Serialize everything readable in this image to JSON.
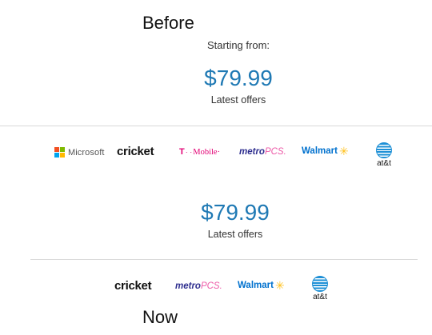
{
  "headings": {
    "before": "Before",
    "now": "Now"
  },
  "before": {
    "starting_label": "Starting from:",
    "price": "$79.99",
    "offers_link": "Latest offers",
    "partners": [
      "Microsoft",
      "cricket",
      "T-Mobile",
      "metroPCS",
      "Walmart",
      "at&t"
    ]
  },
  "now": {
    "price": "$79.99",
    "offers_link": "Latest offers",
    "partners": [
      "cricket",
      "metroPCS",
      "Walmart",
      "at&t"
    ]
  },
  "logo_text": {
    "microsoft": "Microsoft",
    "cricket": "cricket",
    "tmobile_t": "T",
    "tmobile_dots": "· ·",
    "tmobile_name": "Mobile·",
    "metro_a": "metro",
    "metro_b": "PCS.",
    "walmart": "Walmart",
    "walmart_spark": "✳",
    "att": "at&t"
  },
  "colors": {
    "price": "#1f79b4",
    "microsoft": [
      "#f25022",
      "#7fba00",
      "#00a4ef",
      "#ffb900"
    ],
    "tmobile": "#e20074",
    "metro_primary": "#2e2e8f",
    "metro_secondary": "#ed5ba8",
    "walmart_blue": "#0071ce",
    "walmart_yellow": "#ffc220",
    "att_blue": "#1e90d6"
  },
  "icons": {
    "microsoft": "microsoft-logo-icon",
    "att": "att-globe-icon",
    "walmart": "walmart-spark-icon"
  }
}
